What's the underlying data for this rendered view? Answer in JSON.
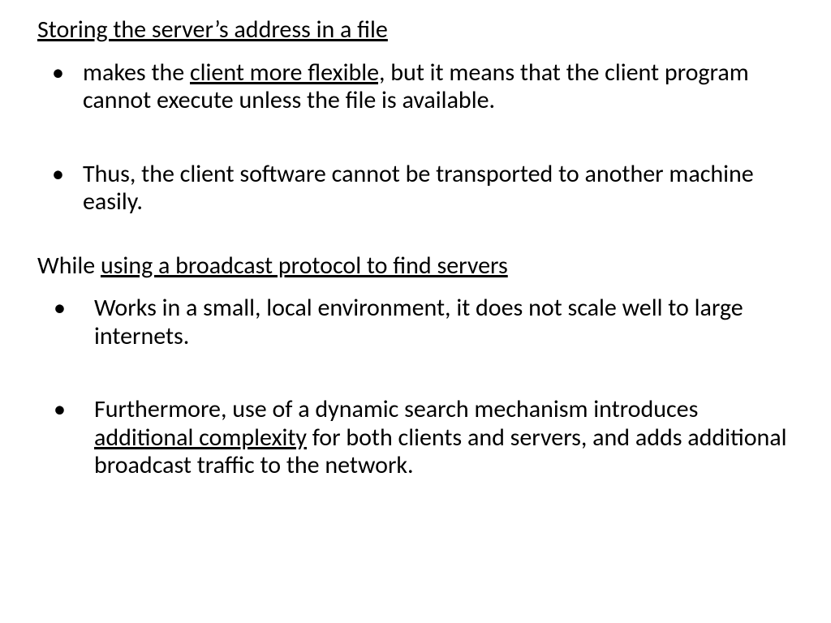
{
  "section1": {
    "heading": "Storing the server’s address in a file",
    "bullet1_pre": "makes the ",
    "bullet1_u": "client more flexible,",
    "bullet1_post": " but it means that the client program cannot execute unless the file is available.",
    "bullet2": "Thus, the client software cannot be transported to another machine easily."
  },
  "section2": {
    "heading_pre": "While ",
    "heading_u": "using a broadcast protocol to find servers",
    "bullet1": "Works in a small, local environment, it does not scale well to large internets.",
    "bullet2_pre": "Furthermore, use of a dynamic search mechanism introduces ",
    "bullet2_u": "additional complexity",
    "bullet2_post": " for both clients and servers, and adds additional broadcast traffic to the network."
  }
}
